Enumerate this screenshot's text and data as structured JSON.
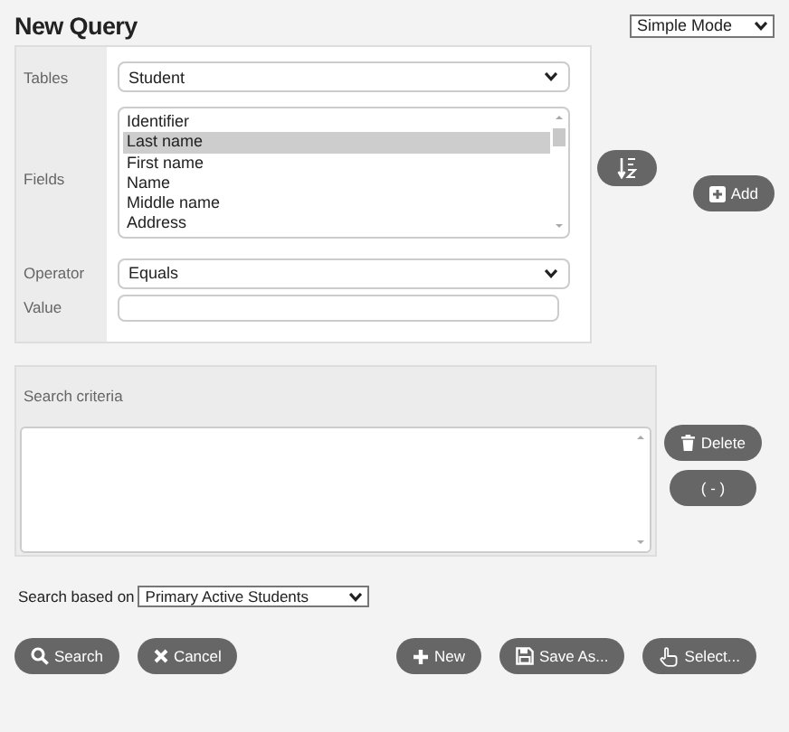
{
  "title": "New Query",
  "mode_select": {
    "value": "Simple Mode"
  },
  "form": {
    "tables": {
      "label": "Tables",
      "value": "Student"
    },
    "fields": {
      "label": "Fields",
      "items": [
        {
          "label": "Identifier",
          "selected": false
        },
        {
          "label": "Last name",
          "selected": true
        },
        {
          "label": "First name",
          "selected": false
        },
        {
          "label": "Name",
          "selected": false
        },
        {
          "label": "Middle name",
          "selected": false
        },
        {
          "label": "Address",
          "selected": false
        }
      ]
    },
    "operator": {
      "label": "Operator",
      "value": "Equals"
    },
    "value": {
      "label": "Value"
    }
  },
  "add_button": "Add",
  "criteria": {
    "header": "Search criteria"
  },
  "side_buttons": [
    {
      "kind": "delete",
      "label": "Delete"
    },
    {
      "kind": "group",
      "label": "( - )"
    }
  ],
  "search_based_on": {
    "label": "Search based on",
    "value": "Primary Active Students"
  },
  "left_buttons": [
    {
      "kind": "search",
      "label": "Search"
    },
    {
      "kind": "cancel",
      "label": "Cancel"
    }
  ],
  "right_buttons": [
    {
      "kind": "new",
      "label": "New"
    },
    {
      "kind": "save",
      "label": "Save As..."
    },
    {
      "kind": "select",
      "label": "Select..."
    }
  ]
}
